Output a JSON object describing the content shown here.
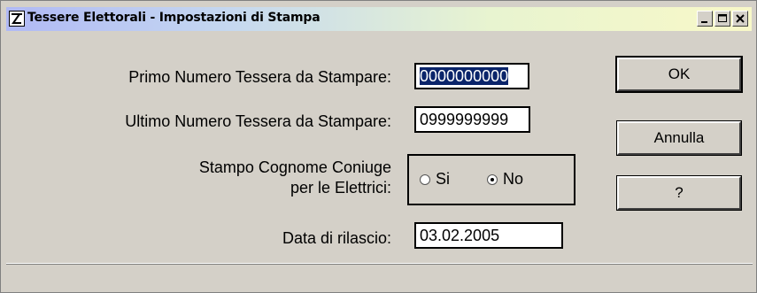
{
  "window": {
    "title": "Tessere Elettorali - Impostazioni di Stampa",
    "controls": {
      "minimize": "_",
      "maximize": "□",
      "close": "×"
    }
  },
  "form": {
    "primo_label": "Primo Numero Tessera da Stampare:",
    "primo_value": "0000000000",
    "ultimo_label": "Ultimo Numero Tessera da Stampare:",
    "ultimo_value": "0999999999",
    "coniuge_label_line1": "Stampo Cognome Coniuge",
    "coniuge_label_line2": "per le Elettrici:",
    "radio_si": "Si",
    "radio_no": "No",
    "radio_selected": "No",
    "data_label": "Data di rilascio:",
    "data_value": "03.02.2005"
  },
  "buttons": {
    "ok": "OK",
    "annulla": "Annulla",
    "help": "?"
  }
}
